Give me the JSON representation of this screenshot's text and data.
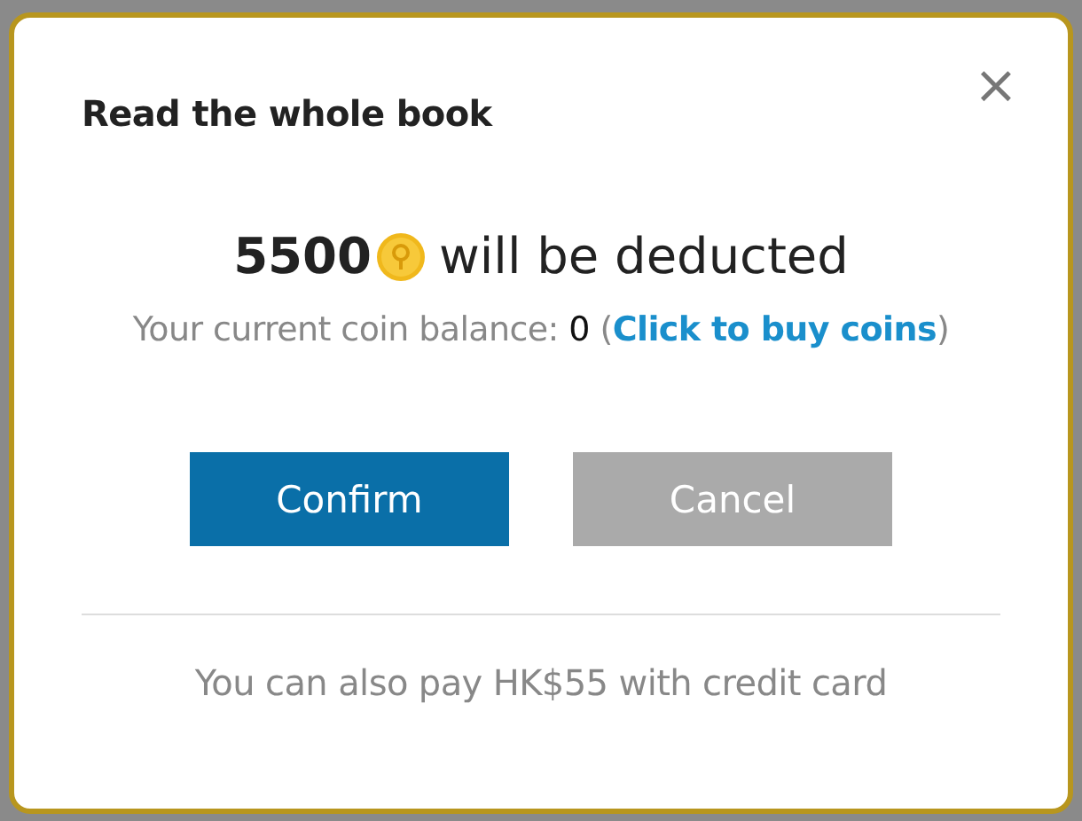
{
  "dialog": {
    "title": "Read the whole book",
    "close": "×"
  },
  "charge": {
    "amount": "5500",
    "text": "will be deducted"
  },
  "balance": {
    "label": "Your current coin balance:",
    "amount": "0",
    "open_paren": "(",
    "link": "Click to buy coins",
    "close_paren": ")"
  },
  "buttons": [
    {
      "label": "Confirm",
      "kind": "primary"
    },
    {
      "label": "Cancel",
      "kind": "secondary"
    }
  ],
  "footer": "You can also pay HK$55 with credit card"
}
